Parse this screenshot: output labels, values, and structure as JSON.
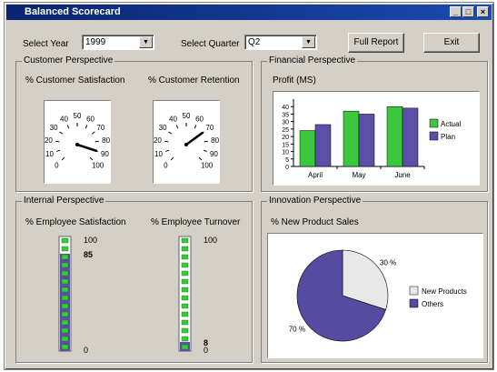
{
  "window": {
    "title": "Balanced Scorecard",
    "controls": [
      "_",
      "□",
      "×"
    ]
  },
  "toolbar": {
    "year_label": "Select Year",
    "year_value": "1999",
    "quarter_label": "Select Quarter",
    "quarter_value": "Q2",
    "full_report_label": "Full Report",
    "exit_label": "Exit"
  },
  "customer": {
    "title": "Customer Perspective",
    "satisfaction": {
      "label": "% Customer Satisfaction",
      "value": 90,
      "ticks": [
        "0",
        "10",
        "20",
        "30",
        "40",
        "50",
        "60",
        "70",
        "80",
        "90",
        "100"
      ]
    },
    "retention": {
      "label": "% Customer Retention",
      "value": 70,
      "ticks": [
        "0",
        "10",
        "20",
        "30",
        "40",
        "50",
        "60",
        "70",
        "80",
        "90",
        "100"
      ]
    }
  },
  "financial": {
    "title": "Financial Perspective"
  },
  "internal": {
    "title": "Internal Perspective",
    "satisfaction": {
      "label": "% Employee Satisfaction",
      "max_label": "100",
      "min_label": "0",
      "value": 85,
      "value_label": "85"
    },
    "turnover": {
      "label": "% Employee Turnover",
      "max_label": "100",
      "min_label": "0",
      "value": 8,
      "value_label": "8"
    }
  },
  "innovation": {
    "title": "Innovation Perspective"
  },
  "colors": {
    "actual": "#3cc83c",
    "plan": "#5a50a8",
    "pie_others": "#554ba0",
    "pie_new": "#e8e8e8"
  },
  "chart_data": [
    {
      "type": "bar",
      "title": "Profit (MS)",
      "categories": [
        "April",
        "May",
        "June"
      ],
      "series": [
        {
          "name": "Actual",
          "values": [
            24,
            37,
            40
          ]
        },
        {
          "name": "Plan",
          "values": [
            28,
            35,
            39
          ]
        }
      ],
      "yticks": [
        "0",
        "5",
        "10",
        "15",
        "20",
        "25",
        "30",
        "35",
        "40"
      ],
      "ylim": [
        0,
        45
      ],
      "legend": "right"
    },
    {
      "type": "pie",
      "title": "% New Product Sales",
      "slices": [
        {
          "name": "New Products",
          "value": 30,
          "label": "30 %"
        },
        {
          "name": "Others",
          "value": 70,
          "label": "70 %"
        }
      ],
      "legend": "right"
    }
  ]
}
